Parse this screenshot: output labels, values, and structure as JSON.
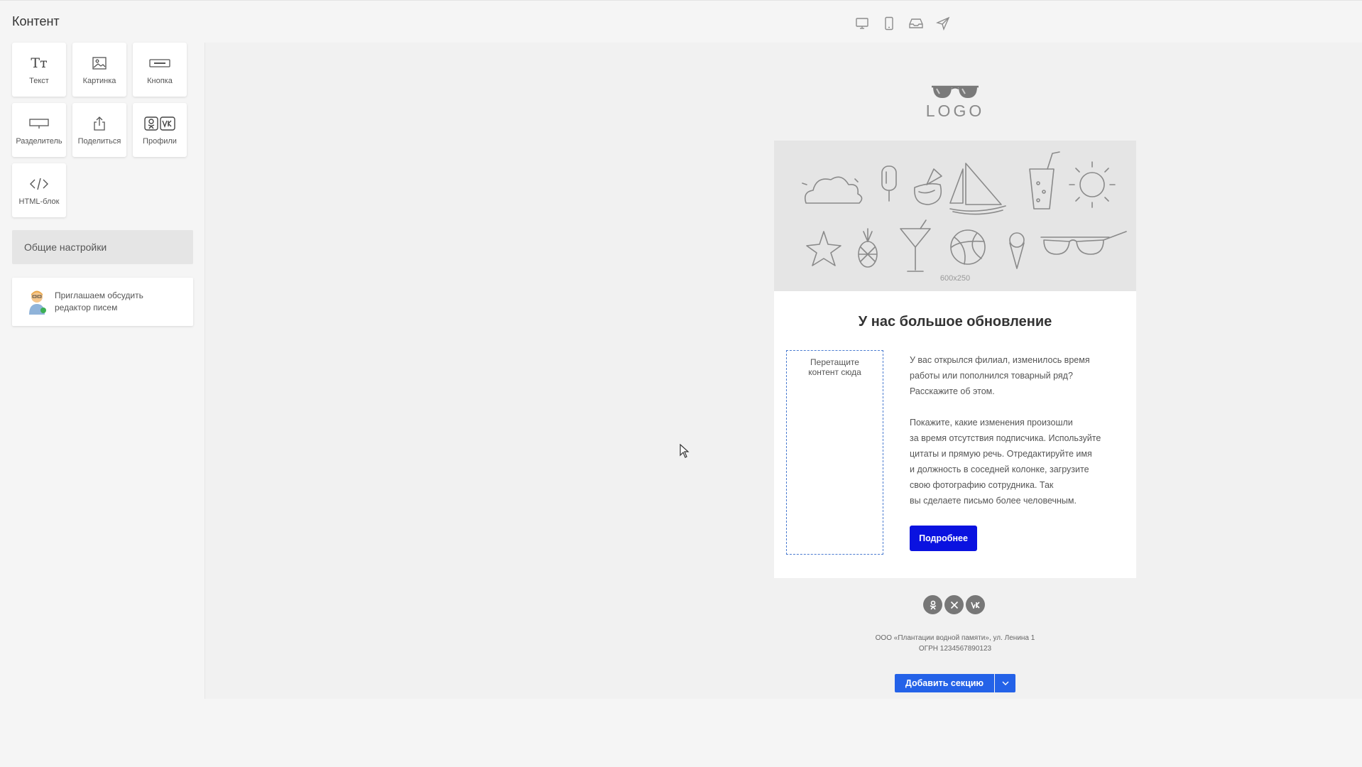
{
  "panel": {
    "title": "Контент"
  },
  "toolbar": {
    "icons": [
      "desktop-icon",
      "mobile-icon",
      "inbox-icon",
      "send-icon"
    ]
  },
  "blocks": [
    {
      "label": "Текст",
      "icon": "text-icon",
      "glyph": "Тт"
    },
    {
      "label": "Картинка",
      "icon": "image-icon"
    },
    {
      "label": "Кнопка",
      "icon": "button-icon"
    },
    {
      "label": "Разделитель",
      "icon": "divider-icon"
    },
    {
      "label": "Поделиться",
      "icon": "share-icon"
    },
    {
      "label": "Профили",
      "icon": "profiles-icon",
      "glyph": "ВК"
    },
    {
      "label": "HTML-блок",
      "icon": "code-icon"
    }
  ],
  "settings": {
    "label": "Общие настройки"
  },
  "invite": {
    "text": "Приглашаем обсудить редактор писем"
  },
  "email": {
    "logo": "LOGO",
    "banner_size": "600x250",
    "heading": "У нас большое обновление",
    "dropzone": "Перетащите\nконтент сюда",
    "paragraph1": "У вас открылся филиал, изменилось время\nработы или пополнился товарный ряд?\nРасскажите об этом.",
    "paragraph2": "Покажите, какие изменения произошли\nза время отсутствия подписчика. Используйте\nцитаты и прямую речь. Отредактируйте имя\nи должность в соседней колонке, загрузите\nсвою фотографию сотрудника. Так\nвы сделаете письмо более человечным.",
    "button": "Подробнее",
    "socials": [
      {
        "name": "odnoklassniki-icon",
        "glyph": "ok"
      },
      {
        "name": "x-icon",
        "glyph": "X"
      },
      {
        "name": "vk-icon",
        "glyph": "vk"
      }
    ],
    "footer_line1": "ООО «Плантации водной памяти», ул. Ленина 1",
    "footer_line2": "ОГРН 1234567890123"
  },
  "add_section": {
    "label": "Добавить секцию"
  },
  "colors": {
    "accent": "#2462e8",
    "button": "#0a12e0"
  }
}
